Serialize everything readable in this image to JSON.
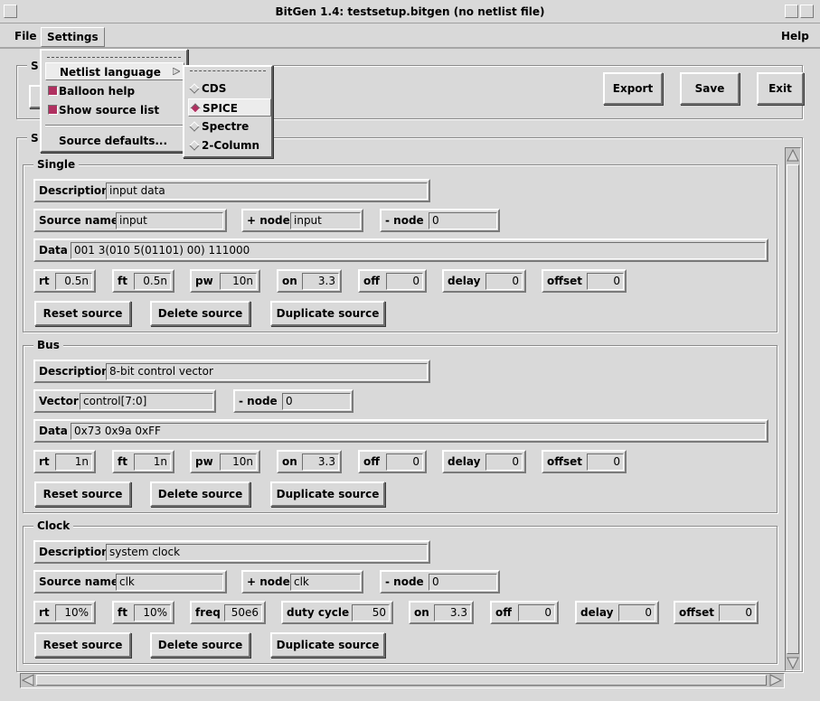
{
  "window": {
    "title": "BitGen 1.4: testsetup.bitgen (no netlist file)"
  },
  "menubar": {
    "file": "File",
    "settings": "Settings",
    "help": "Help"
  },
  "toolbar": {
    "export": "Export",
    "save": "Save",
    "exit": "Exit"
  },
  "settings_menu": {
    "netlist_language": "Netlist language",
    "balloon_help": "Balloon help",
    "show_source_list": "Show source list",
    "source_defaults": "Source defaults..."
  },
  "netlist_submenu": {
    "items": [
      "CDS",
      "SPICE",
      "Spectre",
      "2-Column"
    ],
    "selected": "SPICE"
  },
  "top_frame_fragment": "S",
  "sources_frame_fragment": "S",
  "single": {
    "title": "Single",
    "description_label": "Description",
    "description": "input data",
    "source_name_label": "Source name",
    "source_name": "input",
    "plus_node_label": "+ node",
    "plus_node": "input",
    "minus_node_label": "- node",
    "minus_node": "0",
    "data_label": "Data",
    "data": "001 3(010 5(01101) 00) 111000",
    "rt_label": "rt",
    "rt": "0.5n",
    "ft_label": "ft",
    "ft": "0.5n",
    "pw_label": "pw",
    "pw": "10n",
    "on_label": "on",
    "on": "3.3",
    "off_label": "off",
    "off": "0",
    "delay_label": "delay",
    "delay": "0",
    "offset_label": "offset",
    "offset": "0",
    "reset": "Reset source",
    "delete": "Delete source",
    "duplicate": "Duplicate source"
  },
  "bus": {
    "title": "Bus",
    "description_label": "Description",
    "description": "8-bit control vector",
    "vector_label": "Vector",
    "vector": "control[7:0]",
    "minus_node_label": "- node",
    "minus_node": "0",
    "data_label": "Data",
    "data": "0x73 0x9a 0xFF",
    "rt_label": "rt",
    "rt": "1n",
    "ft_label": "ft",
    "ft": "1n",
    "pw_label": "pw",
    "pw": "10n",
    "on_label": "on",
    "on": "3.3",
    "off_label": "off",
    "off": "0",
    "delay_label": "delay",
    "delay": "0",
    "offset_label": "offset",
    "offset": "0",
    "reset": "Reset source",
    "delete": "Delete source",
    "duplicate": "Duplicate source"
  },
  "clock": {
    "title": "Clock",
    "description_label": "Description",
    "description": "system clock",
    "source_name_label": "Source name",
    "source_name": "clk",
    "plus_node_label": "+ node",
    "plus_node": "clk",
    "minus_node_label": "- node",
    "minus_node": "0",
    "rt_label": "rt",
    "rt": "10%",
    "ft_label": "ft",
    "ft": "10%",
    "freq_label": "freq",
    "freq": "50e6",
    "duty_label": "duty cycle",
    "duty": "50",
    "on_label": "on",
    "on": "3.3",
    "off_label": "off",
    "off": "0",
    "delay_label": "delay",
    "delay": "0",
    "offset_label": "offset",
    "offset": "0",
    "reset": "Reset source",
    "delete": "Delete source",
    "duplicate": "Duplicate source"
  },
  "colors": {
    "accent": "#b03060",
    "background": "#d9d9d9"
  }
}
